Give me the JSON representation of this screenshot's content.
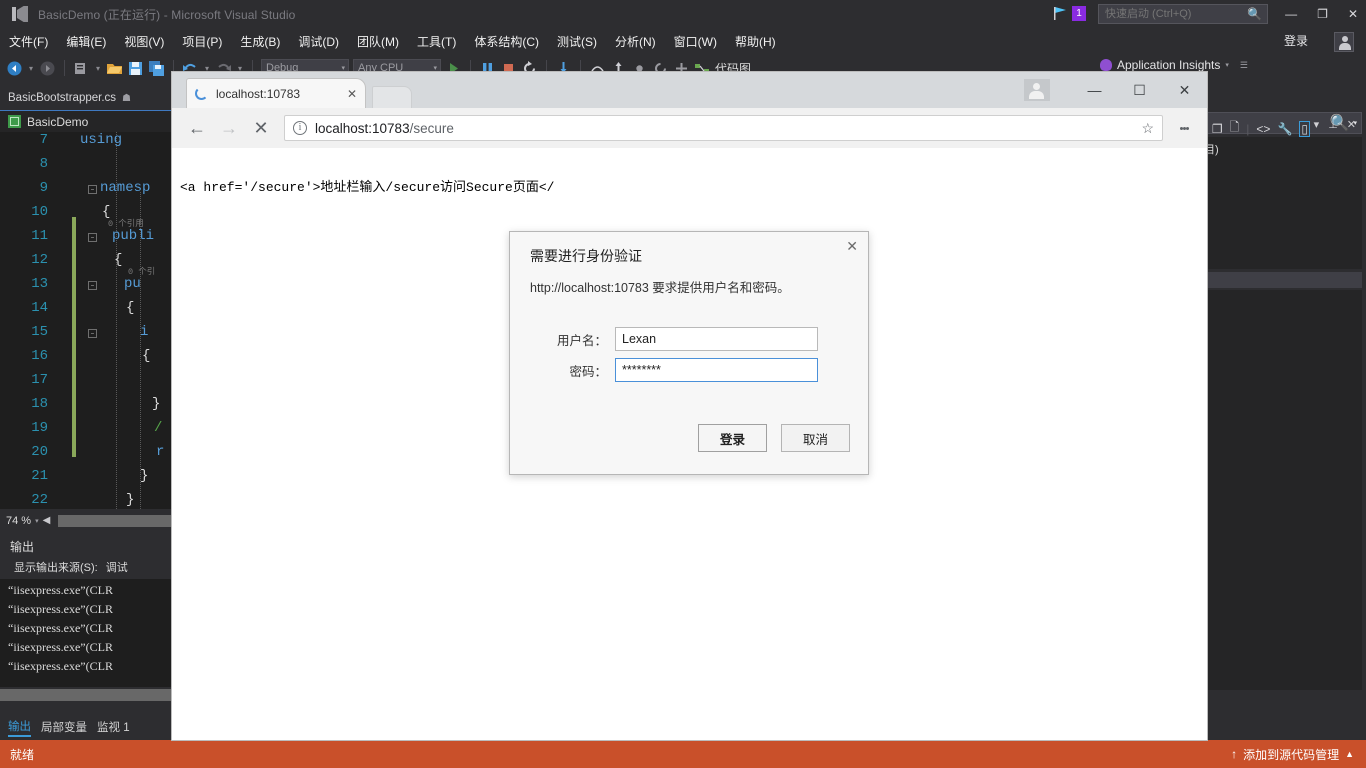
{
  "vs": {
    "title": "BasicDemo (正在运行) - Microsoft Visual Studio",
    "logo_icon": "visual-studio-logo-icon",
    "quick_launch": {
      "placeholder": "快速启动 (Ctrl+Q)",
      "value": "",
      "icon": "search-icon"
    },
    "notification": {
      "count": "1",
      "icon": "notification-flag-icon"
    },
    "window_controls": {
      "minimize": "—",
      "maximize": "❐",
      "close": "✕"
    },
    "menus": [
      "文件(F)",
      "编辑(E)",
      "视图(V)",
      "项目(P)",
      "生成(B)",
      "调试(D)",
      "团队(M)",
      "工具(T)",
      "体系结构(C)",
      "测试(S)",
      "分析(N)",
      "窗口(W)",
      "帮助(H)"
    ],
    "sign_in": "登录",
    "account_icon": "user-account-icon",
    "toolbar": {
      "back_icon": "navigate-back-icon",
      "forward_icon": "navigate-forward-icon",
      "new_project_icon": "new-project-icon",
      "open_file_icon": "open-file-icon",
      "save_icon": "save-icon",
      "save_all_icon": "save-all-icon",
      "undo_icon": "undo-icon",
      "redo_icon": "redo-icon",
      "config": "Debug",
      "platform": "Any CPU",
      "start_icon": "start-debug-icon",
      "pause_icon": "pause-debug-icon",
      "stop_icon": "stop-debug-icon",
      "restart_icon": "restart-debug-icon",
      "step_into_icon": "step-into-icon",
      "step_over_icon": "step-over-icon",
      "step_out_icon": "step-out-icon",
      "code_map_label": "代码图",
      "app_insights": "Application Insights",
      "app_insights_icon": "lightbulb-icon",
      "overflow_icon": "toolbar-overflow-icon"
    },
    "document_tab": {
      "name": "BasicBootstrapper.cs",
      "pin_icon": "pin-icon"
    },
    "nav_bar": {
      "project": "BasicDemo",
      "project_icon": "project-icon"
    },
    "editor": {
      "lines": [
        {
          "num": "7",
          "text": "using",
          "kind": "keyword"
        },
        {
          "num": "8",
          "text": "",
          "kind": "plain"
        },
        {
          "num": "9",
          "text": "namesp",
          "kind": "keyword"
        },
        {
          "num": "10",
          "text": "{",
          "kind": "plain"
        },
        {
          "num": "11",
          "text": "publi",
          "kind": "keyword",
          "lens": "0 个引用"
        },
        {
          "num": "12",
          "text": "{",
          "kind": "plain"
        },
        {
          "num": "13",
          "text": "pu",
          "kind": "keyword",
          "lens": "0 个引"
        },
        {
          "num": "14",
          "text": "{",
          "kind": "plain"
        },
        {
          "num": "15",
          "text": "i",
          "kind": "keyword"
        },
        {
          "num": "16",
          "text": "{",
          "kind": "plain"
        },
        {
          "num": "17",
          "text": "",
          "kind": "plain"
        },
        {
          "num": "18",
          "text": "}",
          "kind": "plain"
        },
        {
          "num": "19",
          "text": "/",
          "kind": "comment"
        },
        {
          "num": "20",
          "text": "r",
          "kind": "keyword"
        },
        {
          "num": "21",
          "text": "}",
          "kind": "plain"
        },
        {
          "num": "22",
          "text": "}",
          "kind": "plain"
        }
      ]
    },
    "zoom_bar": {
      "value": "74 %",
      "caret": "▾"
    },
    "output": {
      "title": "输出",
      "source_label": "显示输出来源(S):",
      "source_value": "调试",
      "lines": [
        "“iisexpress.exe”(CLR",
        "“iisexpress.exe”(CLR",
        "“iisexpress.exe”(CLR",
        "“iisexpress.exe”(CLR",
        "“iisexpress.exe”(CLR"
      ]
    },
    "bottom_tabs": [
      {
        "label": "输出",
        "active": true
      },
      {
        "label": "局部变量",
        "active": false
      },
      {
        "label": "监视 1",
        "active": false
      }
    ],
    "status": {
      "ready": "就绪",
      "source_control": "添加到源代码管理",
      "source_control_icon": "upload-arrow-icon",
      "expand_icon": "chevron-up-icon",
      "color": "#c9502a"
    },
    "right_panel": {
      "partial_text": "目)",
      "search_icon": "search-icon",
      "filter_caret": "▾",
      "toolwindow_controls": {
        "dropdown": "▾",
        "pin": "⊥",
        "close": "✕"
      },
      "toolwindow_icons": [
        "preview-selected-items-icon",
        "copy-icon",
        "show-all-files-icon",
        "properties-wrench-icon",
        "view-designer-icon"
      ]
    }
  },
  "browser": {
    "tab": {
      "title": "localhost:10783",
      "loading_icon": "loading-spinner-icon",
      "close_icon": "close-icon"
    },
    "window_controls": {
      "minimize": "—",
      "maximize": "☐",
      "close": "✕",
      "avatar_icon": "profile-avatar-icon"
    },
    "nav": {
      "back_icon": "arrow-back-icon",
      "forward_icon": "arrow-forward-icon",
      "stop_icon": "stop-loading-icon"
    },
    "omnibox": {
      "info_icon": "page-info-icon",
      "url_host": "localhost:10783",
      "url_path": "/secure",
      "star_icon": "bookmark-star-icon"
    },
    "menu_icon": "three-dot-menu-icon",
    "page": {
      "content": "<a href='/secure'>地址栏输入/secure访问Secure页面</"
    }
  },
  "dialog": {
    "title": "需要进行身份验证",
    "message": "http://localhost:10783 要求提供用户名和密码。",
    "close_icon": "close-icon",
    "username": {
      "label": "用户名：",
      "value": "Lexan",
      "placeholder": ""
    },
    "password": {
      "label": "密码：",
      "value": "••••••••",
      "masked": "********",
      "placeholder": ""
    },
    "buttons": {
      "submit": "登录",
      "cancel": "取消"
    }
  }
}
